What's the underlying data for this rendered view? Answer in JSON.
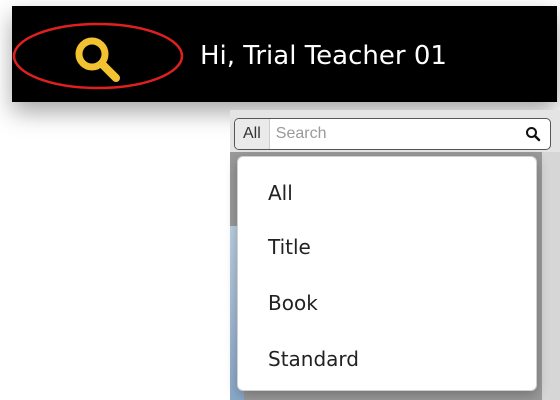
{
  "header": {
    "search_icon": "search-icon",
    "greeting": "Hi, Trial Teacher 01",
    "icon_color": "#f2c230",
    "highlight_color": "#e02020"
  },
  "search": {
    "scope": "All",
    "placeholder": "Search",
    "value": "",
    "button_icon": "search-icon"
  },
  "dropdown": {
    "items": [
      {
        "label": "All"
      },
      {
        "label": "Title"
      },
      {
        "label": "Book"
      },
      {
        "label": "Standard"
      }
    ]
  }
}
